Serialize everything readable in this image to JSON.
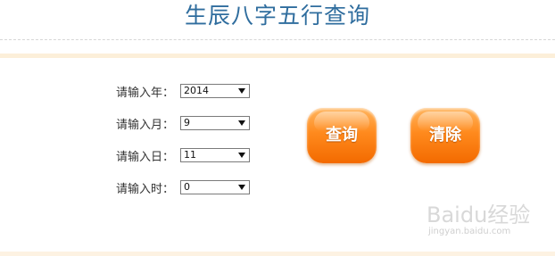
{
  "page": {
    "title": "生辰八字五行查询"
  },
  "form": {
    "rows": [
      {
        "label": "请输入年：",
        "value": "2014"
      },
      {
        "label": "请输入月：",
        "value": "9"
      },
      {
        "label": "请输入日：",
        "value": "11"
      },
      {
        "label": "请输入时：",
        "value": "0"
      }
    ]
  },
  "buttons": {
    "query_label": "查询",
    "clear_label": "清除"
  },
  "watermark": {
    "brand": "Baidu经验",
    "url": "jingyan.baidu.com"
  },
  "colors": {
    "title": "#2f6d9e",
    "button": "#ff8a1d",
    "panel_border": "#fcefd9"
  }
}
